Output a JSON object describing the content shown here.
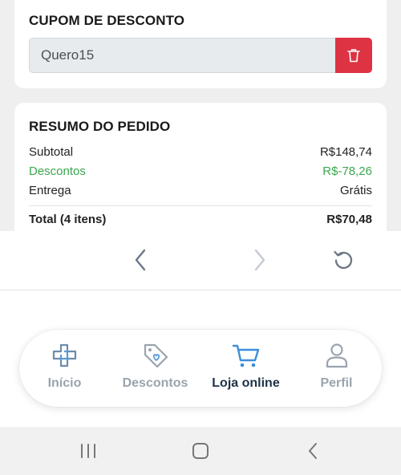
{
  "coupon": {
    "title": "CUPOM DE DESCONTO",
    "code_value": "Quero15"
  },
  "summary": {
    "title": "RESUMO DO PEDIDO",
    "subtotal_label": "Subtotal",
    "subtotal_value": "R$148,74",
    "discount_label": "Descontos",
    "discount_value": "R$-78,26",
    "delivery_label": "Entrega",
    "delivery_value": "Grátis",
    "total_label": "Total (4 itens)",
    "total_value": "R$70,48"
  },
  "browser_nav": {
    "icons": [
      "chevron-left-icon",
      "chevron-right-icon",
      "reload-icon"
    ]
  },
  "tabs": [
    {
      "label": "Início",
      "icon": "home-cross-icon",
      "active": false
    },
    {
      "label": "Descontos",
      "icon": "tag-heart-icon",
      "active": false
    },
    {
      "label": "Loja online",
      "icon": "cart-icon",
      "active": true
    },
    {
      "label": "Perfil",
      "icon": "user-icon",
      "active": false
    }
  ],
  "colors": {
    "accent": "#1d3247",
    "discount": "#3aa84d",
    "danger": "#dd3343",
    "inactive": "#9aa4ae",
    "icon_blue": "#5b9bd5"
  }
}
